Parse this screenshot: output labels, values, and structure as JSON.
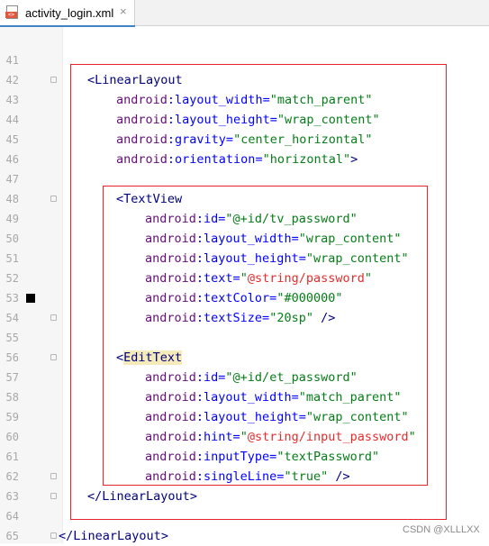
{
  "tab": {
    "filename": "activity_login.xml",
    "close_glyph": "×",
    "file_icon": "xml-file-icon",
    "file_icon_tag": "<>"
  },
  "lines": [
    {
      "num": "41",
      "parts": []
    },
    {
      "num": "42",
      "parts": [
        {
          "t": "<",
          "c": "tg"
        },
        {
          "t": "LinearLayout",
          "c": "tg"
        }
      ]
    },
    {
      "num": "43",
      "parts": [
        {
          "t": "android",
          "c": "pre"
        },
        {
          "t": ":layout_width=",
          "c": "at"
        },
        {
          "t": "\"match_parent\"",
          "c": "sv"
        }
      ]
    },
    {
      "num": "44",
      "parts": [
        {
          "t": "android",
          "c": "pre"
        },
        {
          "t": ":layout_height=",
          "c": "at"
        },
        {
          "t": "\"wrap_content\"",
          "c": "sv"
        }
      ]
    },
    {
      "num": "45",
      "parts": [
        {
          "t": "android",
          "c": "pre"
        },
        {
          "t": ":gravity=",
          "c": "at"
        },
        {
          "t": "\"center_horizontal\"",
          "c": "sv"
        }
      ]
    },
    {
      "num": "46",
      "parts": [
        {
          "t": "android",
          "c": "pre"
        },
        {
          "t": ":orientation=",
          "c": "at"
        },
        {
          "t": "\"horizontal\"",
          "c": "sv"
        },
        {
          "t": ">",
          "c": "tg"
        }
      ]
    },
    {
      "num": "47",
      "parts": []
    },
    {
      "num": "48",
      "parts": [
        {
          "t": "<",
          "c": "tg"
        },
        {
          "t": "TextView",
          "c": "tg"
        }
      ]
    },
    {
      "num": "49",
      "parts": [
        {
          "t": "android",
          "c": "pre"
        },
        {
          "t": ":id=",
          "c": "at"
        },
        {
          "t": "\"@+id/tv_password\"",
          "c": "sv"
        }
      ]
    },
    {
      "num": "50",
      "parts": [
        {
          "t": "android",
          "c": "pre"
        },
        {
          "t": ":layout_width=",
          "c": "at"
        },
        {
          "t": "\"wrap_content\"",
          "c": "sv"
        }
      ]
    },
    {
      "num": "51",
      "parts": [
        {
          "t": "android",
          "c": "pre"
        },
        {
          "t": ":layout_height=",
          "c": "at"
        },
        {
          "t": "\"wrap_content\"",
          "c": "sv"
        }
      ]
    },
    {
      "num": "52",
      "parts": [
        {
          "t": "android",
          "c": "pre"
        },
        {
          "t": ":text=",
          "c": "at"
        },
        {
          "t": "\"",
          "c": "sv"
        },
        {
          "t": "@string/password",
          "c": "rv"
        },
        {
          "t": "\"",
          "c": "sv"
        }
      ]
    },
    {
      "num": "53",
      "parts": [
        {
          "t": "android",
          "c": "pre"
        },
        {
          "t": ":textColor=",
          "c": "at"
        },
        {
          "t": "\"#000000\"",
          "c": "sv"
        }
      ]
    },
    {
      "num": "54",
      "parts": [
        {
          "t": "android",
          "c": "pre"
        },
        {
          "t": ":textSize=",
          "c": "at"
        },
        {
          "t": "\"20sp\"",
          "c": "sv"
        },
        {
          "t": " />",
          "c": "tg"
        }
      ]
    },
    {
      "num": "55",
      "parts": []
    },
    {
      "num": "56",
      "parts": [
        {
          "t": "<",
          "c": "tg"
        },
        {
          "t": "EditText",
          "c": "tg hl"
        }
      ]
    },
    {
      "num": "57",
      "parts": [
        {
          "t": "android",
          "c": "pre"
        },
        {
          "t": ":id=",
          "c": "at"
        },
        {
          "t": "\"@+id/et_password\"",
          "c": "sv"
        }
      ]
    },
    {
      "num": "58",
      "parts": [
        {
          "t": "android",
          "c": "pre"
        },
        {
          "t": ":layout_width=",
          "c": "at"
        },
        {
          "t": "\"match_parent\"",
          "c": "sv"
        }
      ]
    },
    {
      "num": "59",
      "parts": [
        {
          "t": "android",
          "c": "pre"
        },
        {
          "t": ":layout_height=",
          "c": "at"
        },
        {
          "t": "\"wrap_content\"",
          "c": "sv"
        }
      ]
    },
    {
      "num": "60",
      "parts": [
        {
          "t": "android",
          "c": "pre"
        },
        {
          "t": ":hint=",
          "c": "at"
        },
        {
          "t": "\"",
          "c": "sv"
        },
        {
          "t": "@string/input_password",
          "c": "rv"
        },
        {
          "t": "\"",
          "c": "sv"
        }
      ]
    },
    {
      "num": "61",
      "parts": [
        {
          "t": "android",
          "c": "pre"
        },
        {
          "t": ":inputType=",
          "c": "at"
        },
        {
          "t": "\"textPassword\"",
          "c": "sv"
        }
      ]
    },
    {
      "num": "62",
      "parts": [
        {
          "t": "android",
          "c": "pre"
        },
        {
          "t": ":singleLine=",
          "c": "at"
        },
        {
          "t": "\"true\"",
          "c": "sv"
        },
        {
          "t": " />",
          "c": "tg"
        }
      ]
    },
    {
      "num": "63",
      "parts": [
        {
          "t": "</",
          "c": "tg"
        },
        {
          "t": "LinearLayout",
          "c": "tg"
        },
        {
          "t": ">",
          "c": "tg"
        }
      ]
    },
    {
      "num": "64",
      "parts": []
    },
    {
      "num": "65",
      "parts": [
        {
          "t": "</",
          "c": "tg"
        },
        {
          "t": "LinearLayout",
          "c": "tg"
        },
        {
          "t": ">",
          "c": "tg"
        }
      ]
    }
  ],
  "watermark": "CSDN @XLLLXX",
  "colors": {
    "tag": "#000080",
    "attr_prefix": "#660e7a",
    "attr_name": "#0000ff",
    "string_value": "#067d17",
    "resource_ref": "#e32d2d",
    "annotation_box": "#e5262b",
    "tab_underline": "#4083c9"
  }
}
